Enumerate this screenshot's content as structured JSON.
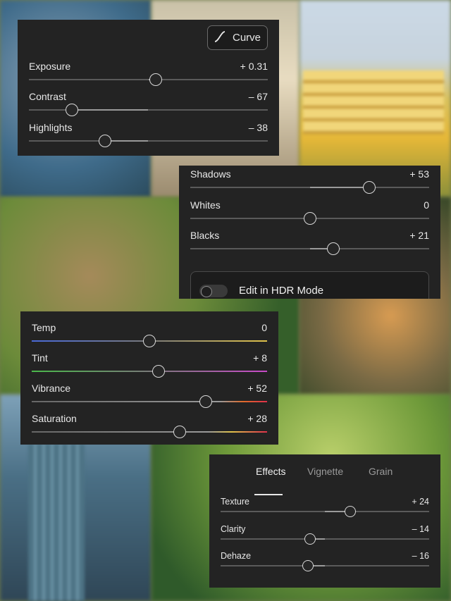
{
  "light_panel": {
    "curve_label": "Curve",
    "sliders": [
      {
        "label": "Exposure",
        "value": "+ 0.31",
        "position": 0.53
      },
      {
        "label": "Contrast",
        "value": "– 67",
        "position": 0.18
      },
      {
        "label": "Highlights",
        "value": "– 38",
        "position": 0.32
      }
    ]
  },
  "tone_panel": {
    "sliders": [
      {
        "label": "Shadows",
        "value": "+ 53",
        "position": 0.75
      },
      {
        "label": "Whites",
        "value": "0",
        "position": 0.5
      },
      {
        "label": "Blacks",
        "value": "+ 21",
        "position": 0.6
      }
    ],
    "hdr_label": "Edit in HDR Mode",
    "hdr_enabled": false
  },
  "color_panel": {
    "sliders": [
      {
        "label": "Temp",
        "value": "0",
        "position": 0.5
      },
      {
        "label": "Tint",
        "value": "+ 8",
        "position": 0.54
      },
      {
        "label": "Vibrance",
        "value": "+ 52",
        "position": 0.74
      },
      {
        "label": "Saturation",
        "value": "+ 28",
        "position": 0.63
      }
    ]
  },
  "effects_panel": {
    "tabs": [
      {
        "label": "Effects",
        "active": true
      },
      {
        "label": "Vignette",
        "active": false
      },
      {
        "label": "Grain",
        "active": false
      }
    ],
    "sliders": [
      {
        "label": "Texture",
        "value": "+ 24",
        "position": 0.62
      },
      {
        "label": "Clarity",
        "value": "– 14",
        "position": 0.43
      },
      {
        "label": "Dehaze",
        "value": "– 16",
        "position": 0.42
      }
    ]
  }
}
